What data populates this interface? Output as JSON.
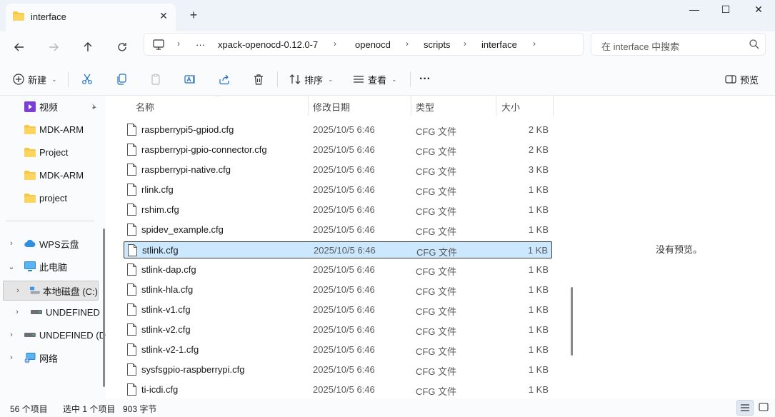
{
  "window": {
    "tab_title": "interface",
    "new_tab_icon": "+",
    "close_tab_icon": "✕",
    "controls": {
      "minimize": "—",
      "maximize": "☐",
      "close": "✕"
    }
  },
  "address": {
    "more": "···",
    "segments": [
      "xpack-openocd-0.12.0-7",
      "openocd",
      "scripts",
      "interface"
    ],
    "search_placeholder": "在 interface 中搜索"
  },
  "toolbar": {
    "new_label": "新建",
    "sort_label": "排序",
    "view_label": "查看",
    "more_label": "···",
    "preview_label": "预览"
  },
  "sidebar": {
    "quick_access": [
      {
        "label": "视频",
        "icon": "video-folder-icon",
        "pinned": true
      },
      {
        "label": "MDK-ARM",
        "icon": "folder-icon"
      },
      {
        "label": "Project",
        "icon": "folder-icon"
      },
      {
        "label": "MDK-ARM",
        "icon": "folder-icon"
      },
      {
        "label": "project",
        "icon": "folder-icon"
      }
    ],
    "tree": [
      {
        "label": "WPS云盘",
        "icon": "cloud-icon",
        "expanded": false
      },
      {
        "label": "此电脑",
        "icon": "computer-icon",
        "expanded": true
      },
      {
        "label": "本地磁盘 (C:)",
        "icon": "disk-icon",
        "expanded": false,
        "selected": true
      },
      {
        "label": "UNDEFINED",
        "icon": "drive-icon",
        "expanded": false
      },
      {
        "label": "UNDEFINED (D",
        "icon": "drive-icon",
        "expanded": false
      },
      {
        "label": "网络",
        "icon": "network-icon",
        "expanded": false
      }
    ]
  },
  "columns": {
    "name": "名称",
    "date": "修改日期",
    "type": "类型",
    "size": "大小"
  },
  "files": [
    {
      "name": "raspberrypi5-gpiod.cfg",
      "date": "2025/10/5 6:46",
      "type": "CFG 文件",
      "size": "2 KB"
    },
    {
      "name": "raspberrypi-gpio-connector.cfg",
      "date": "2025/10/5 6:46",
      "type": "CFG 文件",
      "size": "2 KB"
    },
    {
      "name": "raspberrypi-native.cfg",
      "date": "2025/10/5 6:46",
      "type": "CFG 文件",
      "size": "3 KB"
    },
    {
      "name": "rlink.cfg",
      "date": "2025/10/5 6:46",
      "type": "CFG 文件",
      "size": "1 KB"
    },
    {
      "name": "rshim.cfg",
      "date": "2025/10/5 6:46",
      "type": "CFG 文件",
      "size": "1 KB"
    },
    {
      "name": "spidev_example.cfg",
      "date": "2025/10/5 6:46",
      "type": "CFG 文件",
      "size": "1 KB"
    },
    {
      "name": "stlink.cfg",
      "date": "2025/10/5 6:46",
      "type": "CFG 文件",
      "size": "1 KB",
      "selected": true
    },
    {
      "name": "stlink-dap.cfg",
      "date": "2025/10/5 6:46",
      "type": "CFG 文件",
      "size": "1 KB"
    },
    {
      "name": "stlink-hla.cfg",
      "date": "2025/10/5 6:46",
      "type": "CFG 文件",
      "size": "1 KB"
    },
    {
      "name": "stlink-v1.cfg",
      "date": "2025/10/5 6:46",
      "type": "CFG 文件",
      "size": "1 KB"
    },
    {
      "name": "stlink-v2.cfg",
      "date": "2025/10/5 6:46",
      "type": "CFG 文件",
      "size": "1 KB"
    },
    {
      "name": "stlink-v2-1.cfg",
      "date": "2025/10/5 6:46",
      "type": "CFG 文件",
      "size": "1 KB"
    },
    {
      "name": "sysfsgpio-raspberrypi.cfg",
      "date": "2025/10/5 6:46",
      "type": "CFG 文件",
      "size": "1 KB"
    },
    {
      "name": "ti-icdi.cfg",
      "date": "2025/10/5 6:46",
      "type": "CFG 文件",
      "size": "1 KB"
    }
  ],
  "preview": {
    "empty_text": "没有预览。"
  },
  "status": {
    "item_count": "56 个项目",
    "selection": "选中 1 个项目",
    "selection_size": "903 字节"
  },
  "colors": {
    "selection_fill": "#cce8ff",
    "folder_yellow": "#f7c843",
    "accent_blue": "#1f6fc5"
  }
}
